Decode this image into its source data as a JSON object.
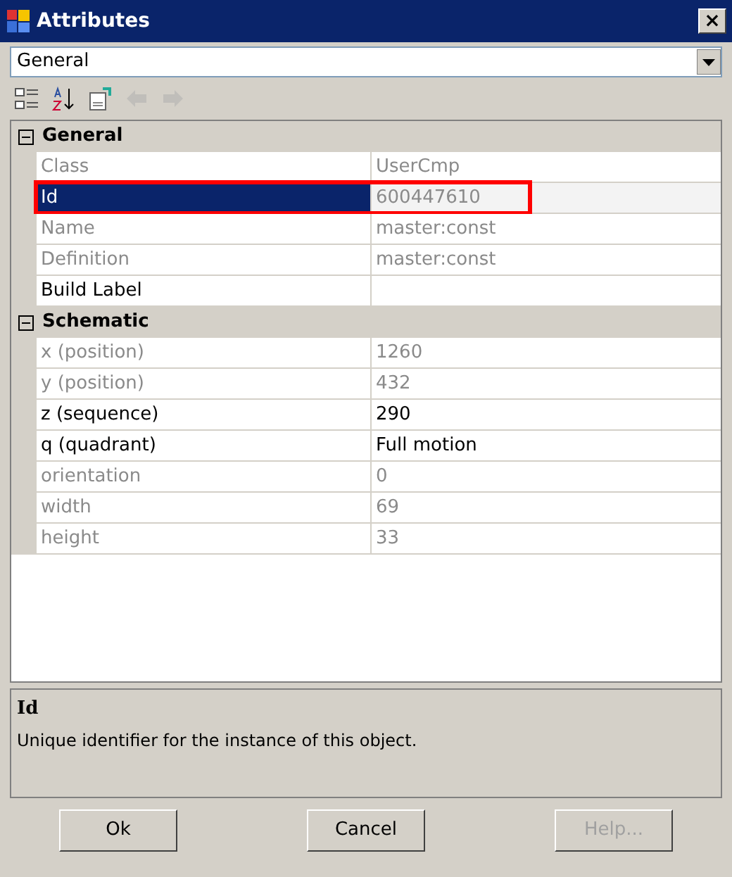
{
  "window": {
    "title": "Attributes",
    "close": "×"
  },
  "object_selector": {
    "value": "General"
  },
  "toolbar": [
    {
      "kind": "categorized",
      "disabled": false
    },
    {
      "kind": "alphabetical",
      "disabled": false
    },
    {
      "kind": "pages",
      "disabled": false
    },
    {
      "kind": "back",
      "disabled": true
    },
    {
      "kind": "forward",
      "disabled": true
    }
  ],
  "categories": [
    {
      "label": "General",
      "expanded": true,
      "properties": [
        {
          "name": "Class",
          "value": "UserCmp",
          "disabled": true,
          "selected": false,
          "highlighted": false
        },
        {
          "name": "Id",
          "value": "600447610",
          "disabled": true,
          "selected": true,
          "highlighted": true
        },
        {
          "name": "Name",
          "value": "master:const",
          "disabled": true,
          "selected": false,
          "highlighted": false
        },
        {
          "name": "Definition",
          "value": "master:const",
          "disabled": true,
          "selected": false,
          "highlighted": false
        },
        {
          "name": "Build Label",
          "disabled": false,
          "selected": false,
          "highlighted": false
        }
      ]
    },
    {
      "label": "Schematic",
      "expanded": true,
      "properties": [
        {
          "name": "x (position)",
          "value": "1260",
          "disabled": true,
          "selected": false,
          "highlighted": false
        },
        {
          "name": "y (position)",
          "value": "432",
          "disabled": true,
          "selected": false,
          "highlighted": false
        },
        {
          "name": "z (sequence)",
          "value": "290",
          "disabled": false,
          "selected": false,
          "highlighted": false
        },
        {
          "name": "q (quadrant)",
          "value": "Full motion",
          "disabled": false,
          "selected": false,
          "highlighted": false
        },
        {
          "name": "orientation",
          "value": "0",
          "disabled": true,
          "selected": false,
          "highlighted": false
        },
        {
          "name": "width",
          "value": "69",
          "disabled": true,
          "selected": false,
          "highlighted": false
        },
        {
          "name": "height",
          "value": "33",
          "disabled": true,
          "selected": false,
          "highlighted": false
        }
      ]
    }
  ],
  "description": {
    "title": "Id",
    "text": "Unique identifier for the instance of this object."
  },
  "buttons": [
    {
      "label": "Ok",
      "disabled": false
    },
    {
      "label": "Cancel",
      "disabled": false
    },
    {
      "label": "Help...",
      "disabled": true
    }
  ]
}
